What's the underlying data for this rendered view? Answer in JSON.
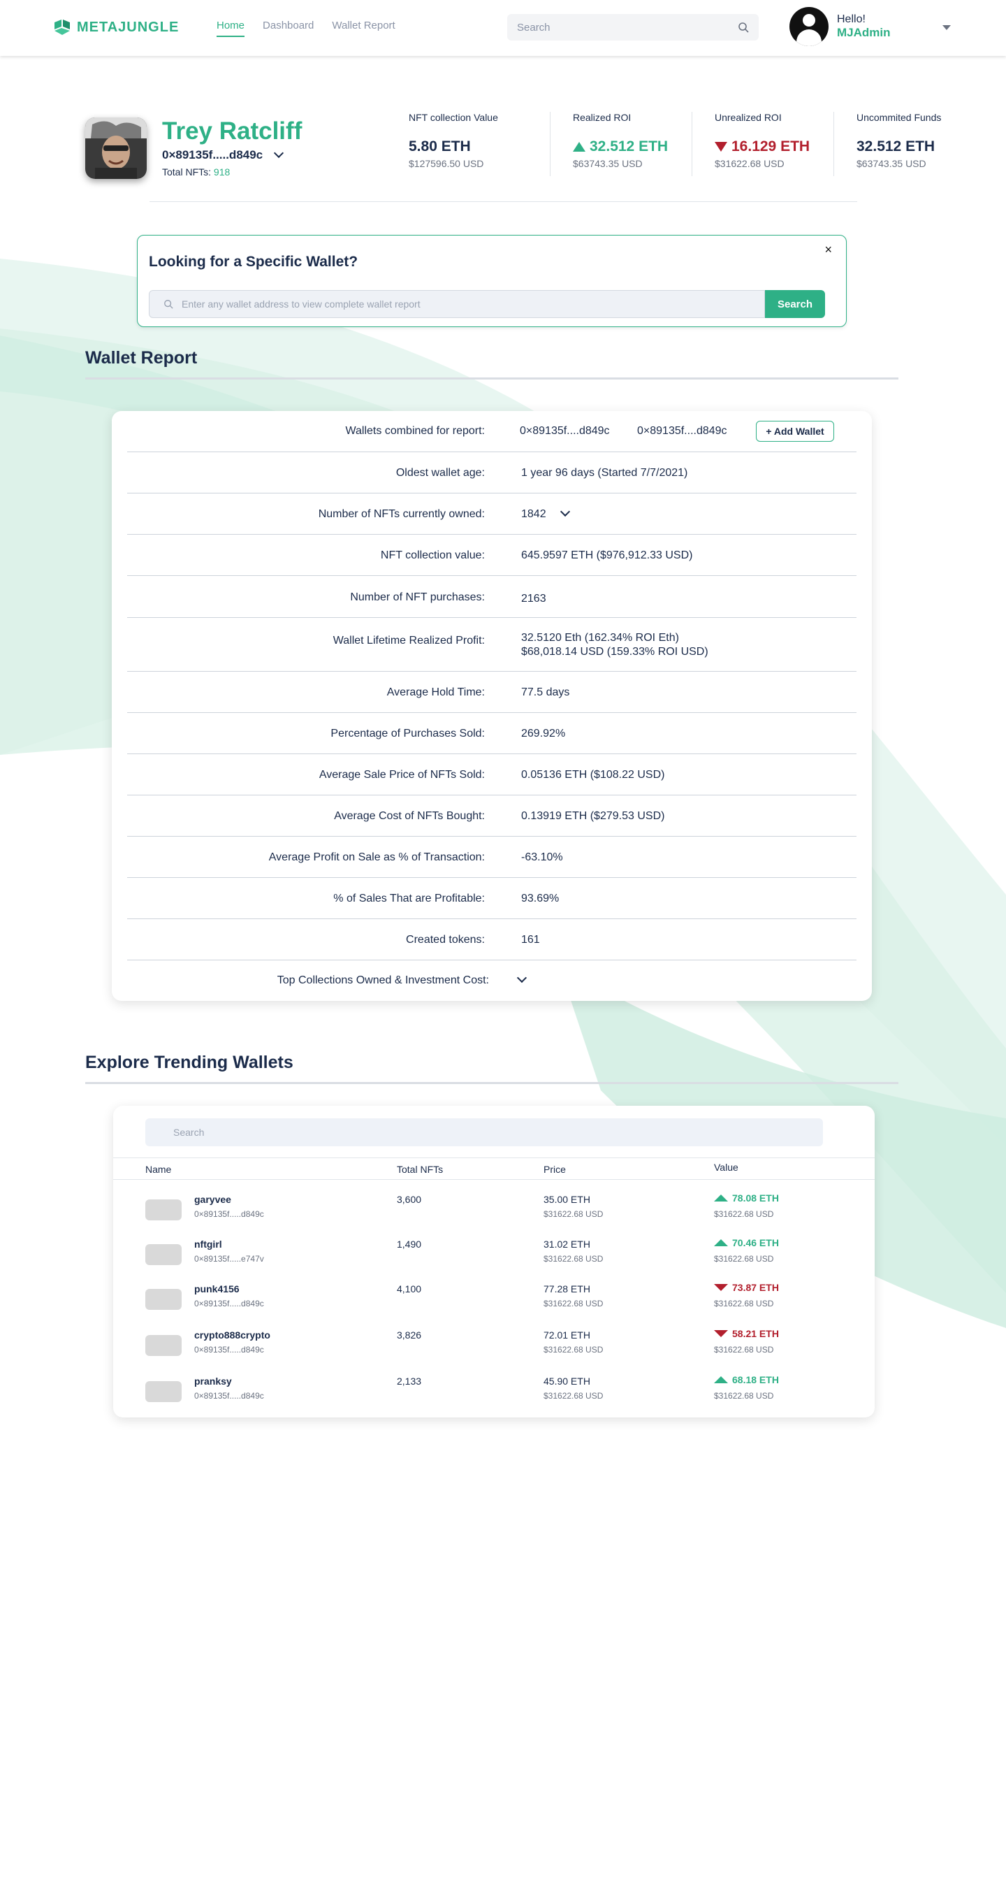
{
  "brand": {
    "name": "METAJUNGLE",
    "accent": "#2eb086",
    "negative": "#b21f2d"
  },
  "nav": {
    "items": [
      {
        "label": "Home",
        "active": true
      },
      {
        "label": "Dashboard"
      },
      {
        "label": "Wallet Report"
      }
    ]
  },
  "header": {
    "search_placeholder": "Search",
    "greeting": "Hello!",
    "username": "MJAdmin"
  },
  "profile": {
    "name": "Trey Ratcliff",
    "address": "0×89135f.....d849c",
    "total_label": "Total NFTs:",
    "total_value": "918"
  },
  "stats": [
    {
      "label": "NFT collection Value",
      "value": "5.80 ETH",
      "sub": "$127596.50 USD",
      "trend": "none"
    },
    {
      "label": "Realized ROI",
      "value": "32.512 ETH",
      "sub": "$63743.35 USD",
      "trend": "up"
    },
    {
      "label": "Unrealized ROI",
      "value": "16.129 ETH",
      "sub": "$31622.68 USD",
      "trend": "down"
    },
    {
      "label": "Uncommited Funds",
      "value": "32.512 ETH",
      "sub": "$63743.35 USD",
      "trend": "none"
    }
  ],
  "lookup": {
    "title": "Looking for a Specific Wallet?",
    "placeholder": "Enter any wallet address to view complete wallet report",
    "button": "Search",
    "close": "×"
  },
  "report": {
    "title": "Wallet Report",
    "wallets_label": "Wallets combined for report:",
    "wallet_1": "0×89135f....d849c",
    "wallet_2": "0×89135f....d849c",
    "add_wallet": "+ Add Wallet",
    "rows": [
      {
        "label": "Oldest wallet age:",
        "value": "1 year 96 days (Started 7/7/2021)"
      },
      {
        "label": "Number of NFTs currently owned:",
        "value": "1842"
      },
      {
        "label": "NFT collection value:",
        "value": "645.9597 ETH ($976,912.33 USD)"
      },
      {
        "label": "Number of NFT purchases:",
        "value": "2163"
      },
      {
        "label": "Wallet Lifetime Realized Profit:",
        "value": "32.5120 Eth (162.34% ROI Eth)",
        "value2": "$68,018.14 USD (159.33% ROI USD)"
      },
      {
        "label": "Average Hold Time:",
        "value": "77.5 days"
      },
      {
        "label": "Percentage of Purchases Sold:",
        "value": "269.92%"
      },
      {
        "label": "Average Sale Price of NFTs Sold:",
        "value": "0.05136 ETH ($108.22 USD)"
      },
      {
        "label": "Average Cost of NFTs Bought:",
        "value": "0.13919 ETH ($279.53 USD)"
      },
      {
        "label": "Average Profit on Sale as % of Transaction:",
        "value": "-63.10%"
      },
      {
        "label": "% of Sales That are Profitable:",
        "value": "93.69%"
      },
      {
        "label": "Created tokens:",
        "value": "161"
      },
      {
        "label": "Top Collections Owned & Investment Cost:",
        "value": ""
      }
    ]
  },
  "trending": {
    "title": "Explore Trending Wallets",
    "search_placeholder": "Search",
    "columns": {
      "name": "Name",
      "nfts": "Total NFTs",
      "price": "Price",
      "value": "Value"
    },
    "rows": [
      {
        "name": "garyvee",
        "address": "0×89135f.....d849c",
        "nfts": "3,600",
        "price": "35.00 ETH",
        "price_usd": "$31622.68 USD",
        "value": "78.08 ETH",
        "value_usd": "$31622.68 USD",
        "trend": "up"
      },
      {
        "name": "nftgirl",
        "address": "0×89135f.....e747v",
        "nfts": "1,490",
        "price": "31.02 ETH",
        "price_usd": "$31622.68 USD",
        "value": "70.46 ETH",
        "value_usd": "$31622.68 USD",
        "trend": "up"
      },
      {
        "name": "punk4156",
        "address": "0×89135f.....d849c",
        "nfts": "4,100",
        "price": "77.28 ETH",
        "price_usd": "$31622.68 USD",
        "value": "73.87 ETH",
        "value_usd": "$31622.68 USD",
        "trend": "down"
      },
      {
        "name": "crypto888crypto",
        "address": "0×89135f.....d849c",
        "nfts": "3,826",
        "price": "72.01 ETH",
        "price_usd": "$31622.68 USD",
        "value": "58.21 ETH",
        "value_usd": "$31622.68 USD",
        "trend": "down"
      },
      {
        "name": "pranksy",
        "address": "0×89135f.....d849c",
        "nfts": "2,133",
        "price": "45.90 ETH",
        "price_usd": "$31622.68 USD",
        "value": "68.18 ETH",
        "value_usd": "$31622.68 USD",
        "trend": "up"
      }
    ]
  }
}
